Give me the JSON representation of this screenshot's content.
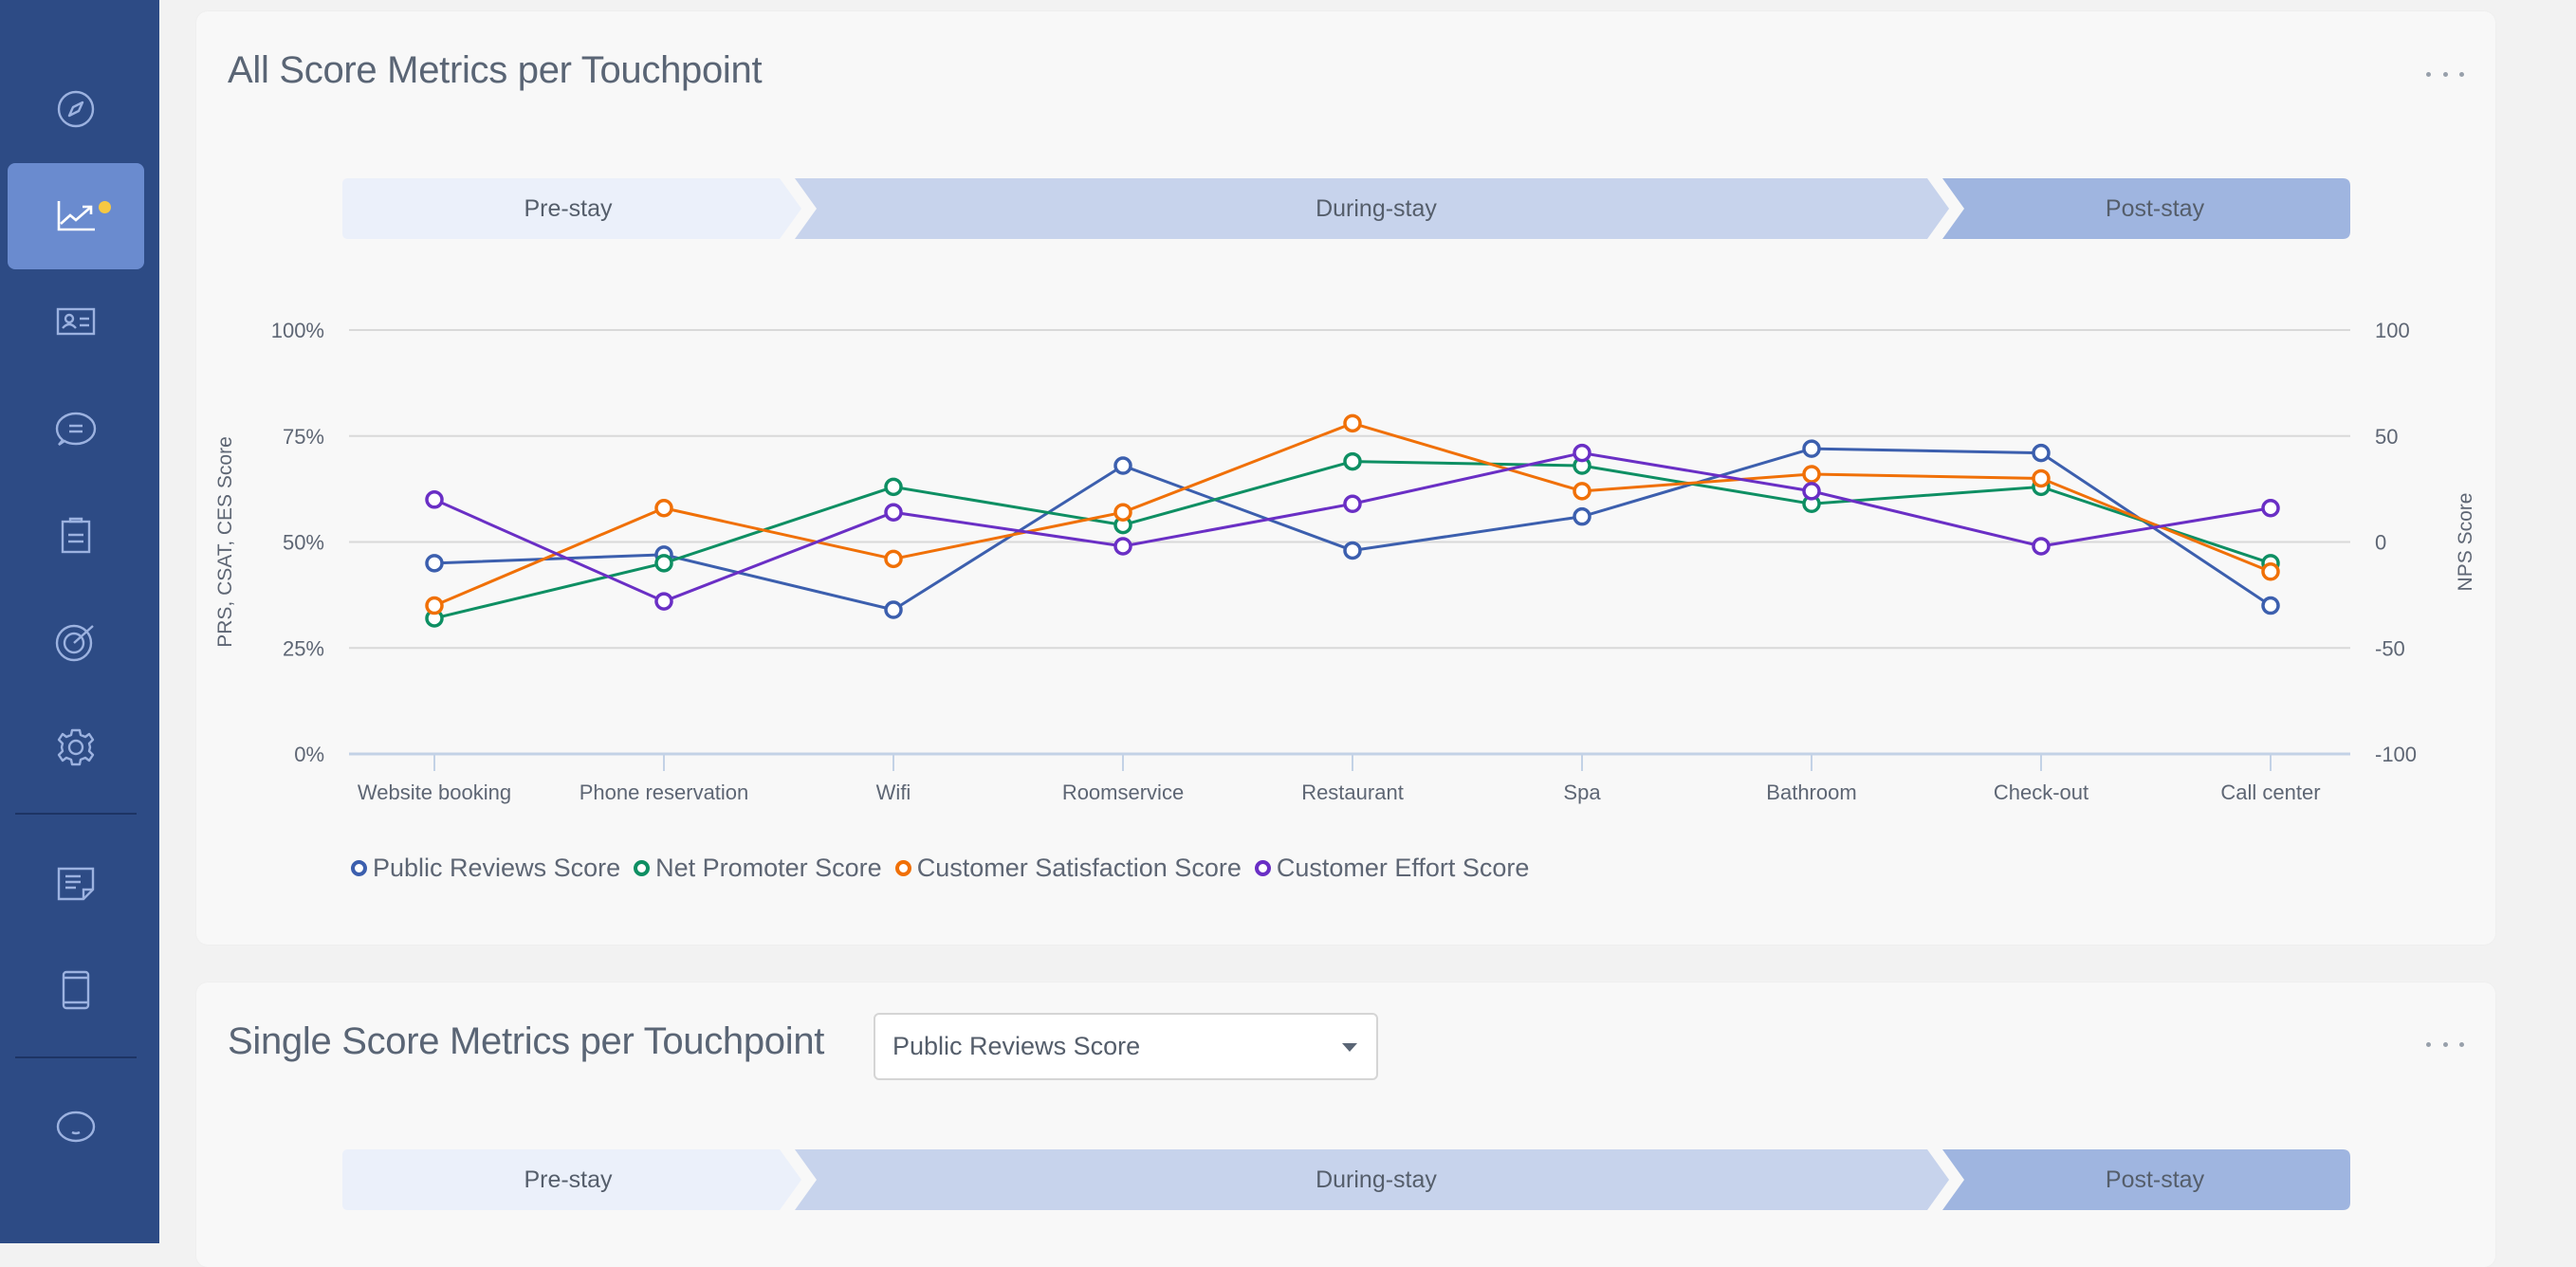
{
  "sidebar": {
    "items": [
      {
        "icon": "compass-icon",
        "label": "Explore",
        "active": false
      },
      {
        "icon": "trending-chart-icon",
        "label": "Analytics",
        "active": true,
        "badge": true
      },
      {
        "icon": "contact-card-icon",
        "label": "Contacts",
        "active": false
      },
      {
        "icon": "chat-bubble-icon",
        "label": "Messages",
        "active": false
      },
      {
        "icon": "clipboard-icon",
        "label": "Surveys",
        "active": false
      },
      {
        "icon": "target-icon",
        "label": "Goals",
        "active": false
      },
      {
        "icon": "gear-icon",
        "label": "Settings",
        "active": false
      },
      {
        "icon": "note-icon",
        "label": "Notes",
        "active": false
      },
      {
        "icon": "tablet-icon",
        "label": "Devices",
        "active": false
      },
      {
        "icon": "smiley-icon",
        "label": "Profile",
        "active": false
      }
    ],
    "badge_color": "#f6c842"
  },
  "card1": {
    "title": "All Score Metrics per Touchpoint",
    "journey": [
      "Pre-stay",
      "During-stay",
      "Post-stay"
    ]
  },
  "card2": {
    "title": "Single Score Metrics per Touchpoint",
    "dropdown_value": "Public Reviews Score",
    "journey": [
      "Pre-stay",
      "During-stay",
      "Post-stay"
    ]
  },
  "colors": {
    "prs": "#3c5fae",
    "nps": "#0e8f63",
    "csat": "#f07007",
    "ces": "#6a2fc5",
    "journey_pre": "#ebf0fa",
    "journey_during": "#c7d3ec",
    "journey_post": "#9fb5e0"
  },
  "chart_data": {
    "type": "line",
    "title": "All Score Metrics per Touchpoint",
    "categories": [
      "Website booking",
      "Phone reservation",
      "Wifi",
      "Roomservice",
      "Restaurant",
      "Spa",
      "Bathroom",
      "Check-out",
      "Call center"
    ],
    "ylabel": "PRS, CSAT, CES Score",
    "y2label": "NPS Score",
    "ylim": [
      0,
      100
    ],
    "y2lim": [
      -100,
      100
    ],
    "yticks": [
      "0%",
      "25%",
      "50%",
      "75%",
      "100%"
    ],
    "y2ticks": [
      "-100",
      "-50",
      "0",
      "50",
      "100"
    ],
    "grid": true,
    "legend_position": "bottom-left",
    "series": [
      {
        "key": "prs",
        "name": "Public Reviews Score",
        "axis": "left",
        "values": [
          45,
          47,
          34,
          68,
          48,
          56,
          72,
          71,
          35
        ]
      },
      {
        "key": "nps",
        "name": "Net Promoter Score",
        "axis": "right",
        "values": [
          -36,
          -10,
          26,
          8,
          38,
          36,
          18,
          26,
          -10
        ]
      },
      {
        "key": "csat",
        "name": "Customer Satisfaction Score",
        "axis": "left",
        "values": [
          35,
          58,
          46,
          57,
          78,
          62,
          66,
          65,
          43
        ]
      },
      {
        "key": "ces",
        "name": "Customer Effort Score",
        "axis": "left",
        "values": [
          60,
          36,
          57,
          49,
          59,
          71,
          62,
          49,
          58
        ]
      }
    ]
  }
}
